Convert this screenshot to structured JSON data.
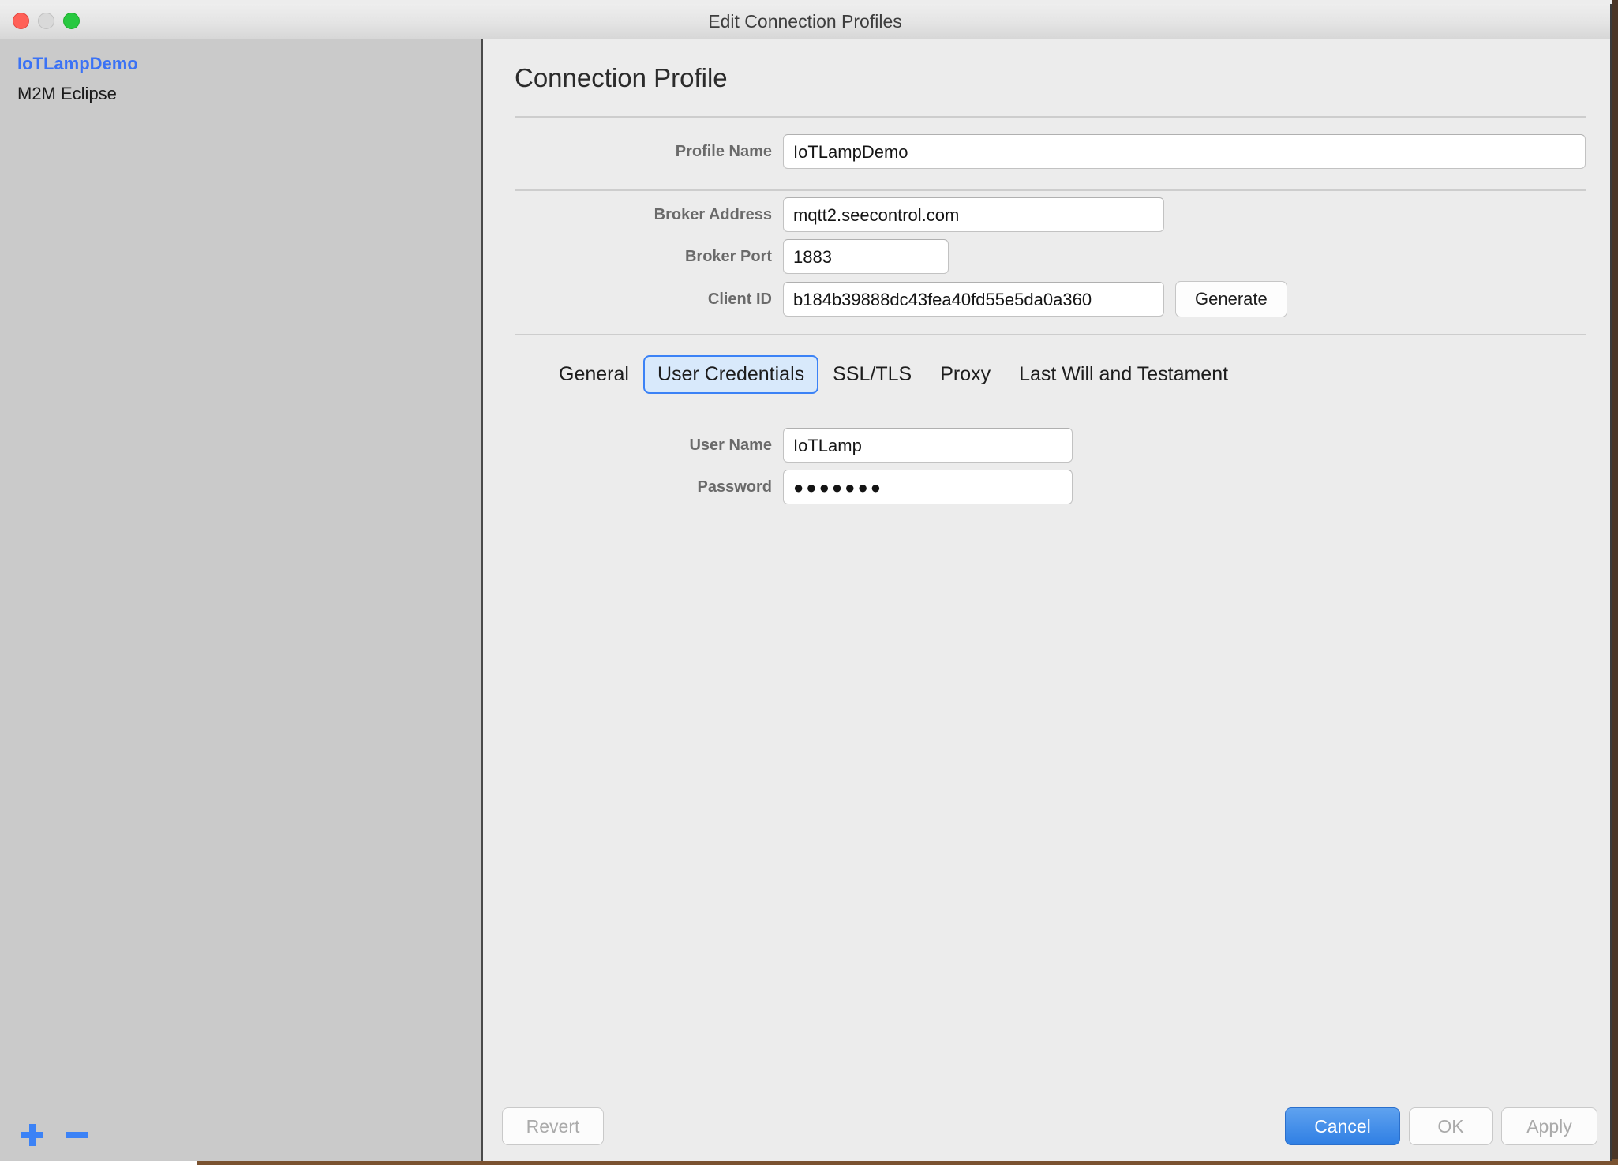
{
  "window": {
    "title": "Edit Connection Profiles",
    "traffic_lights": [
      "close-button",
      "minimize-button",
      "zoom-button"
    ]
  },
  "sidebar": {
    "profiles": [
      {
        "label": "IoTLampDemo",
        "selected": true
      },
      {
        "label": "M2M Eclipse",
        "selected": false
      }
    ],
    "add_button_label": "+",
    "remove_button_label": "−"
  },
  "content": {
    "section_title": "Connection Profile",
    "fields": {
      "profile_name": {
        "label": "Profile Name",
        "value": "IoTLampDemo"
      },
      "broker_address": {
        "label": "Broker Address",
        "value": "mqtt2.seecontrol.com"
      },
      "broker_port": {
        "label": "Broker Port",
        "value": "1883"
      },
      "client_id": {
        "label": "Client ID",
        "value": "b184b39888dc43fea40fd55e5da0a360"
      }
    },
    "generate_button_label": "Generate",
    "tabs": [
      {
        "label": "General",
        "active": false
      },
      {
        "label": "User Credentials",
        "active": true
      },
      {
        "label": "SSL/TLS",
        "active": false
      },
      {
        "label": "Proxy",
        "active": false
      },
      {
        "label": "Last Will and Testament",
        "active": false
      }
    ],
    "credentials": {
      "user_name": {
        "label": "User Name",
        "value": "IoTLamp"
      },
      "password": {
        "label": "Password",
        "value": "●●●●●●●"
      }
    }
  },
  "footer": {
    "revert_label": "Revert",
    "cancel_label": "Cancel",
    "ok_label": "OK",
    "apply_label": "Apply"
  },
  "colors": {
    "accent_blue": "#3b82f6",
    "primary_button": "#2f7fe4",
    "selected_profile": "#3b72f5",
    "tab_active_fill": "#d8e9fb",
    "sidebar_bg": "#cacaca",
    "content_bg": "#ececec",
    "close_red": "#ff6057",
    "minimize_gray": "#d9d9d9",
    "zoom_green": "#28c840"
  }
}
